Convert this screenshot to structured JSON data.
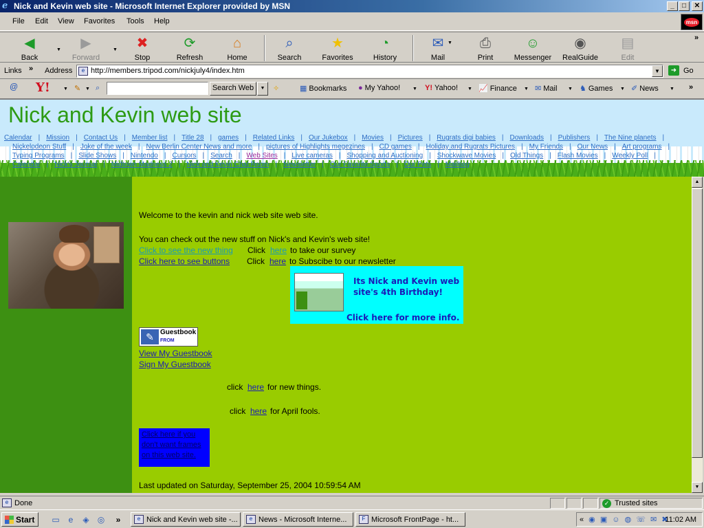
{
  "window": {
    "title": "Nick and Kevin web site - Microsoft Internet Explorer provided by MSN",
    "minimize": "_",
    "maximize": "□",
    "close": "✕"
  },
  "menu": {
    "items": [
      "File",
      "Edit",
      "View",
      "Favorites",
      "Tools",
      "Help"
    ],
    "brand": "msn"
  },
  "toolbar": {
    "back": "Back",
    "forward": "Forward",
    "stop": "Stop",
    "refresh": "Refresh",
    "home": "Home",
    "search": "Search",
    "favorites": "Favorites",
    "history": "History",
    "mail": "Mail",
    "print": "Print",
    "messenger": "Messenger",
    "realguide": "RealGuide",
    "edit": "Edit"
  },
  "address": {
    "links_label": "Links",
    "label": "Address",
    "url": "http://members.tripod.com/nickjuly4/index.htm",
    "go_label": "Go"
  },
  "yahoo_toolbar": {
    "logo": "Y!",
    "search_value": "",
    "search_button": "Search Web",
    "items": [
      "Bookmarks",
      "My Yahoo!",
      "Yahoo!",
      "Finance",
      "Mail",
      "Games",
      "News"
    ]
  },
  "header": {
    "site_title": "Nick and Kevin web site",
    "nav_rows": [
      [
        "Calendar",
        "Mission",
        "Contact Us",
        "Member list",
        "Title 28",
        "games",
        "Related Links",
        "Our Jukebox",
        "Movies",
        "Pictures",
        "Rugrats digi babies",
        "Downloads",
        "Publishers",
        "The Nine planets"
      ],
      [
        "Nickelodeon Stuff",
        "Joke of the week",
        "New Berlin Center News and more",
        "pictures of Highlights megezines",
        "CD games",
        "Holiday and Rugrats Pictures",
        "My Friends",
        "Our News",
        "Art programs"
      ],
      [
        "Typing Programs",
        "Slide Shows",
        "Nintendo",
        "Cursors",
        "Search",
        "Web Sites",
        "Live cameras",
        "Shopping and Auctioning",
        "Shockwave Movies",
        "Old Things",
        "Flash Movies",
        "Weekly Poll"
      ],
      [
        "Calendar",
        "Nick's Journal",
        "Midtown Madness 2",
        "Nick and Kevin Chat Room",
        "Newsletter",
        "Our Favorite Sports",
        "Our Pets",
        "Mailbag"
      ]
    ]
  },
  "main": {
    "welcome": "Welcome to the kevin and nick web site web site.",
    "check_out": "You can check out the new stuff on Nick's and Kevin's web site!",
    "new_thing_link": "Click to see the new thing",
    "click_word": "Click",
    "here_word": "here",
    "survey_suffix": "to take our survey",
    "buttons_link": "Click here to see buttons",
    "newsletter_suffix": "to Subscibe to our newsletter",
    "birthday_title": "Its Nick and Kevin web site's 4th Birthday!",
    "birthday_link": "Click here for more info.",
    "guestbook_label": "Guestbook",
    "guestbook_from": "FROM",
    "view_guestbook": "View My Guestbook",
    "sign_guestbook": "Sign My Guestbook",
    "click_lower": "click",
    "new_things_suffix": "for new things.",
    "april_suffix": "for April fools.",
    "no_frames": "Click here if you don't want frames on this web site.",
    "last_updated": "Last updated on Saturday, September 25, 2004 10:59:54 AM"
  },
  "status": {
    "text": "Done",
    "zone": "Trusted sites"
  },
  "taskbar": {
    "start": "Start",
    "tasks": [
      "Nick and Kevin web site -...",
      "News - Microsoft Interne...",
      "Microsoft FrontPage - ht..."
    ],
    "clock": "11:02 AM",
    "chevron": "«"
  }
}
